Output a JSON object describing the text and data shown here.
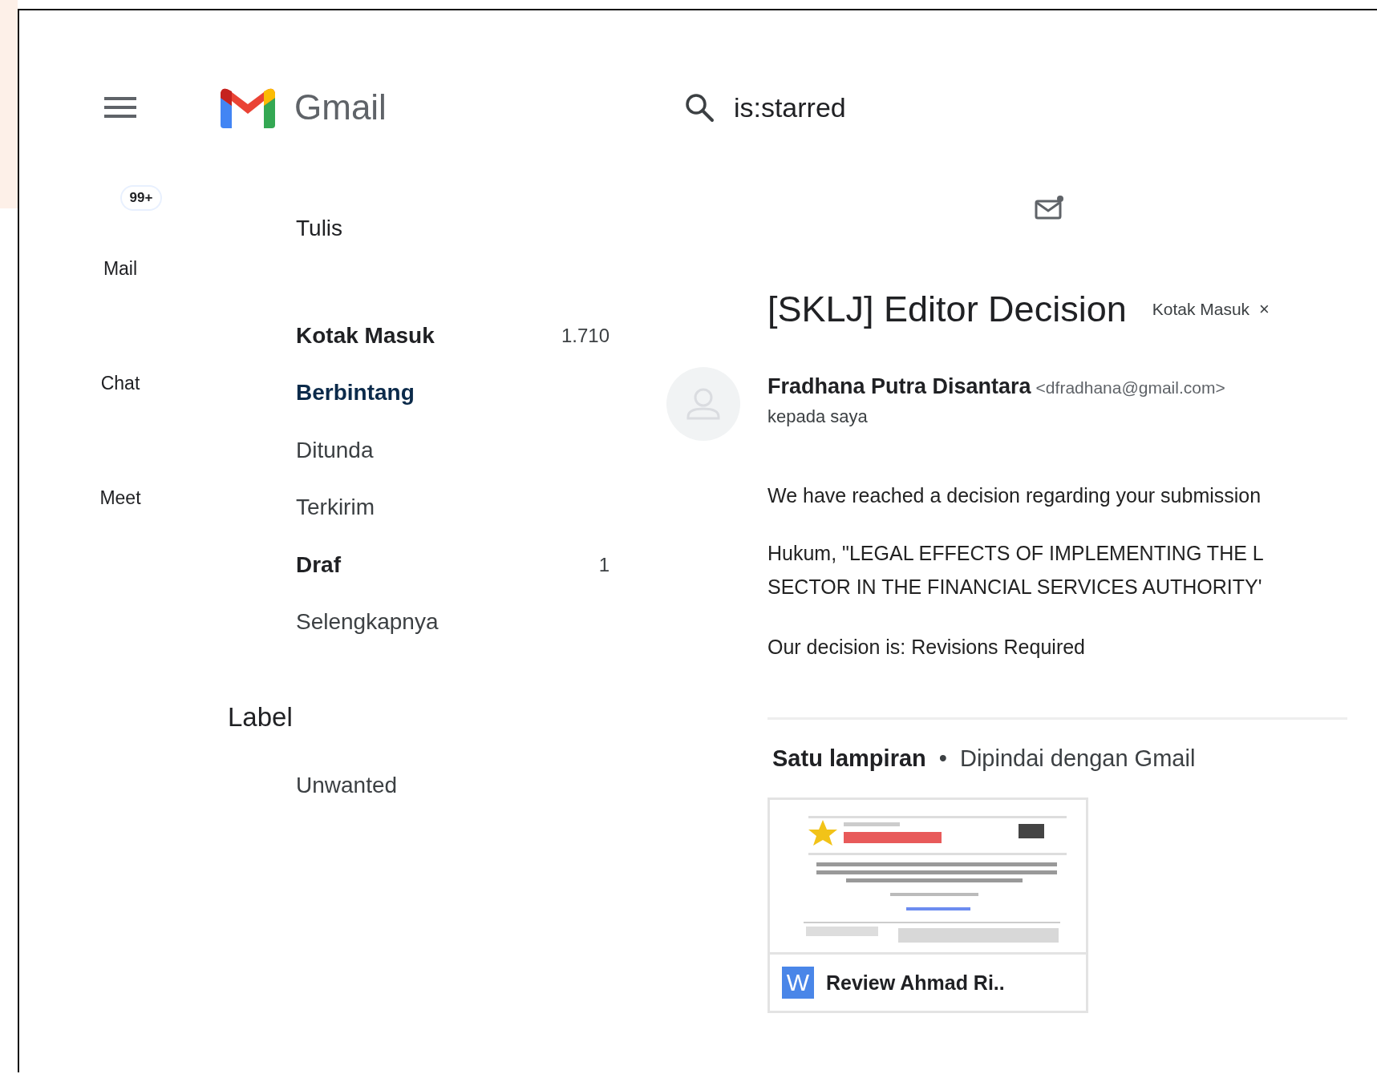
{
  "header": {
    "app_name": "Gmail",
    "search": {
      "value": "is:starred"
    }
  },
  "rail": {
    "items": [
      {
        "label": "Mail",
        "badge": "99+"
      },
      {
        "label": "Chat"
      },
      {
        "label": "Meet"
      }
    ]
  },
  "compose": {
    "label": "Tulis"
  },
  "folders": [
    {
      "label": "Kotak Masuk",
      "count": "1.710",
      "unread": true,
      "selected": false
    },
    {
      "label": "Berbintang",
      "unread": false,
      "selected": true
    },
    {
      "label": "Ditunda",
      "unread": false,
      "selected": false
    },
    {
      "label": "Terkirim",
      "unread": false,
      "selected": false
    },
    {
      "label": "Draf",
      "count": "1",
      "unread": true,
      "selected": false
    },
    {
      "label": "Selengkapnya",
      "unread": false,
      "selected": false
    }
  ],
  "labels_section": {
    "title": "Label",
    "items": [
      {
        "label": "Unwanted"
      }
    ]
  },
  "message": {
    "subject": "[SKLJ] Editor Decision",
    "tag": {
      "label": "Kotak Masuk",
      "remove": "×"
    },
    "sender": {
      "name": "Fradhana Putra Disantara",
      "email": "<dfradhana@gmail.com>"
    },
    "recipient": "kepada saya",
    "body": [
      {
        "lines": [
          "We have reached a decision regarding your submission"
        ]
      },
      {
        "lines": [
          "Hukum, \"LEGAL EFFECTS OF IMPLEMENTING THE L",
          "SECTOR IN THE FINANCIAL SERVICES AUTHORITY'"
        ]
      },
      {
        "lines": [
          "Our decision is: Revisions Required"
        ]
      }
    ],
    "attachments": {
      "summary": "Satu lampiran",
      "separator": "•",
      "scan_note": "Dipindai dengan Gmail",
      "files": [
        {
          "name": "Review Ahmad Ri..",
          "icon_letter": "W"
        }
      ]
    }
  }
}
